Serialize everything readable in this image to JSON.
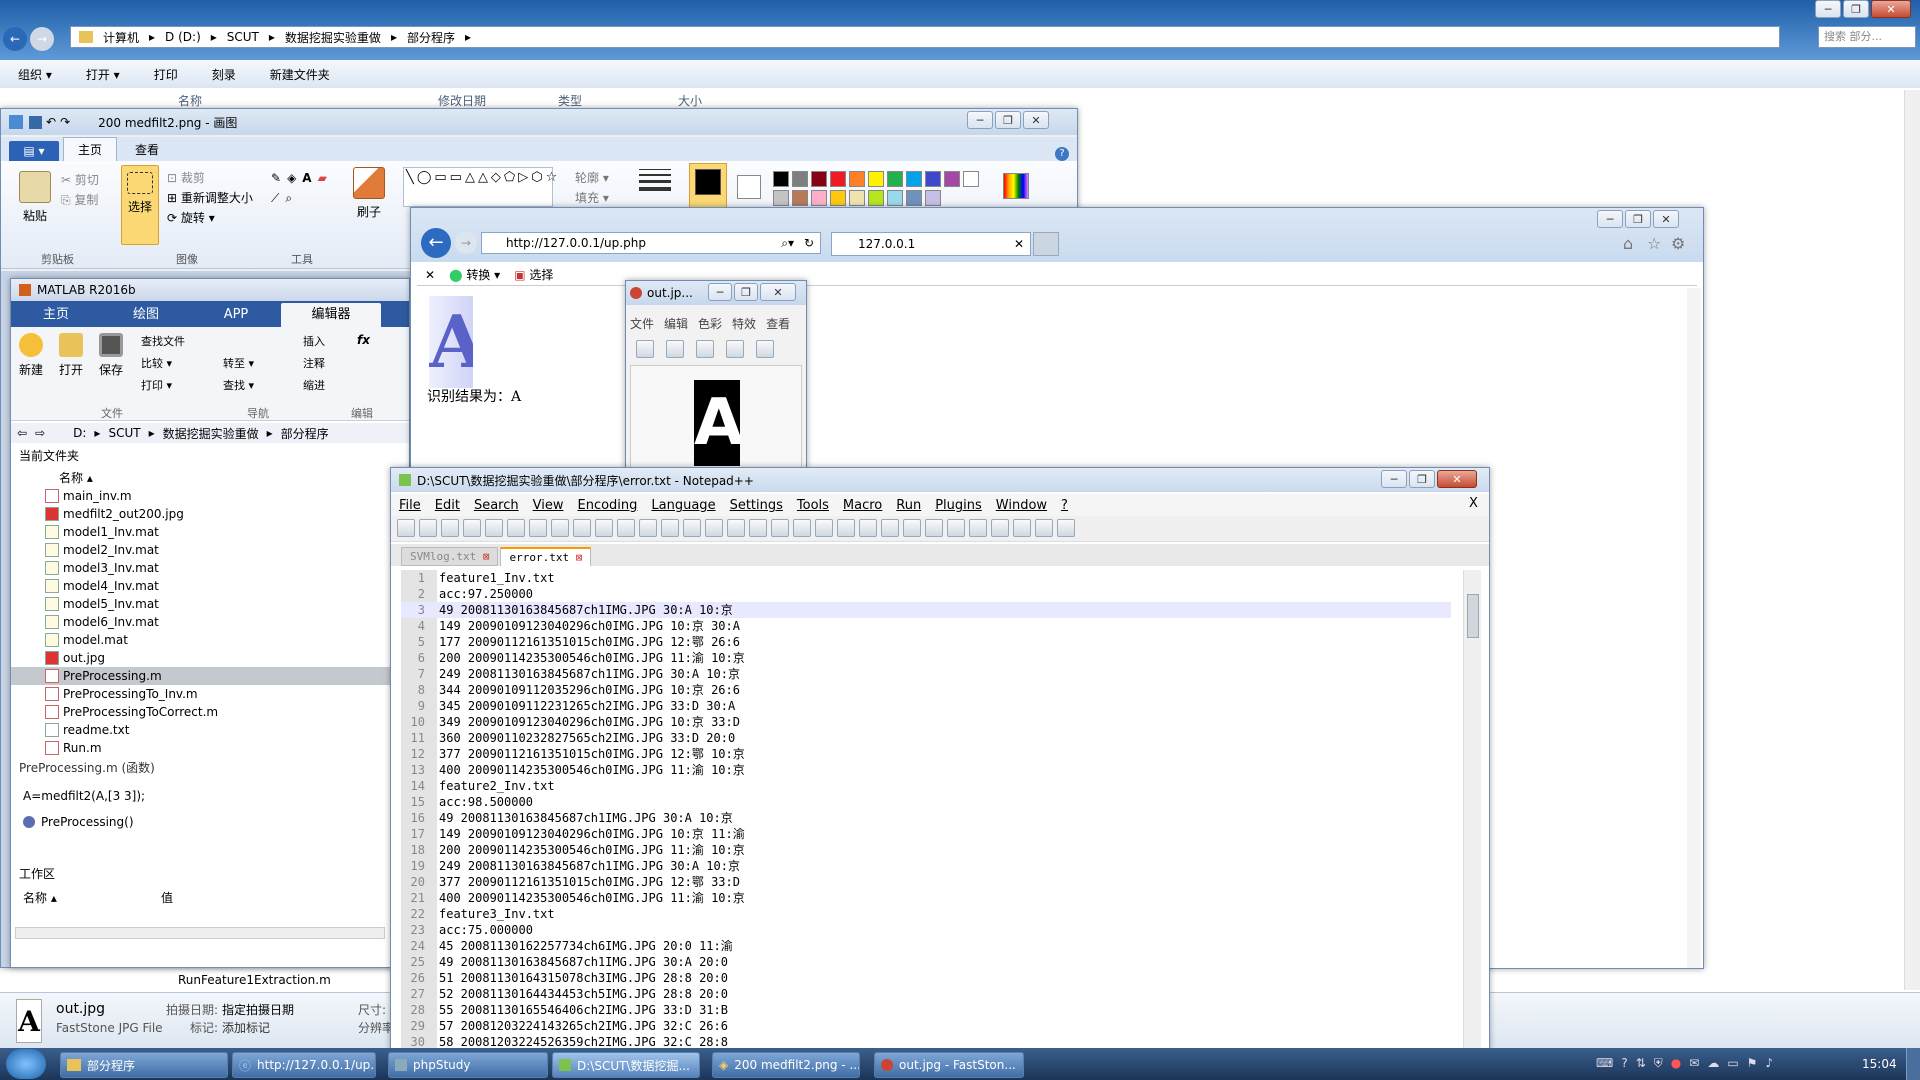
{
  "explorer": {
    "breadcrumb": [
      "计算机",
      "D (D:)",
      "SCUT",
      "数据挖掘实验重做",
      "部分程序"
    ],
    "search_placeholder": "搜索 部分...",
    "toolbar": [
      "组织 ▾",
      "打开 ▾",
      "打印",
      "刻录",
      "新建文件夹"
    ],
    "columns": [
      "名称",
      "修改日期",
      "类型",
      "大小"
    ],
    "status": {
      "name": "out.jpg",
      "type": "FastStone JPG File",
      "k1": "拍摄日期:",
      "v1": "指定拍摄日期",
      "k2": "标记:",
      "v2": "添加标记",
      "k3": "尺寸:",
      "k4": "分辨率:"
    },
    "hidden_file": "RunFeature1Extraction.m"
  },
  "paint": {
    "title": "200 medfilt2.png - 画图",
    "tabs": [
      "主页",
      "查看"
    ],
    "clipboard": {
      "paste": "粘贴",
      "cut": "剪切",
      "copy": "复制",
      "group": "剪贴板"
    },
    "image": {
      "select": "选择",
      "crop": "裁剪",
      "resize": "重新调整大小",
      "rotate": "旋转 ▾",
      "group": "图像"
    },
    "tools_group": "工具",
    "brush": "刷子",
    "outline": "轮廓 ▾",
    "fill": "填充 ▾",
    "palette": [
      "#000000",
      "#7f7f7f",
      "#880015",
      "#ed1c24",
      "#ff7f27",
      "#fff200",
      "#22b14c",
      "#00a2e8",
      "#3f48cc",
      "#a349a4",
      "#ffffff",
      "#c3c3c3",
      "#b97a57",
      "#ffaec9",
      "#ffc90e",
      "#efe4b0",
      "#b5e61d",
      "#99d9ea",
      "#7092be",
      "#c8bfe7"
    ]
  },
  "matlab": {
    "title": "MATLAB R2016b",
    "tabs": [
      "主页",
      "绘图",
      "APP",
      "编辑器"
    ],
    "file_group": [
      "新建",
      "打开",
      "保存"
    ],
    "find_files": "查找文件",
    "compare": "比较 ▾",
    "print": "打印 ▾",
    "goto": "转至 ▾",
    "find": "查找 ▾",
    "insert": "插入",
    "comment": "注释",
    "indent": "缩进",
    "groups": [
      "文件",
      "导航",
      "编辑"
    ],
    "path": [
      "D:",
      "SCUT",
      "数据挖掘实验重做",
      "部分程序"
    ],
    "current_folder": "当前文件夹",
    "name_col": "名称 ▴",
    "files": [
      {
        "name": "main_inv.m",
        "type": "m"
      },
      {
        "name": "medfilt2_out200.jpg",
        "type": "jpg"
      },
      {
        "name": "model1_Inv.mat",
        "type": "mat"
      },
      {
        "name": "model2_Inv.mat",
        "type": "mat"
      },
      {
        "name": "model3_Inv.mat",
        "type": "mat"
      },
      {
        "name": "model4_Inv.mat",
        "type": "mat"
      },
      {
        "name": "model5_Inv.mat",
        "type": "mat"
      },
      {
        "name": "model6_Inv.mat",
        "type": "mat"
      },
      {
        "name": "model.mat",
        "type": "mat"
      },
      {
        "name": "out.jpg",
        "type": "jpg"
      },
      {
        "name": "PreProcessing.m",
        "type": "m",
        "selected": true
      },
      {
        "name": "PreProcessingTo_Inv.m",
        "type": "m"
      },
      {
        "name": "PreProcessingToCorrect.m",
        "type": "m"
      },
      {
        "name": "readme.txt",
        "type": "txt"
      },
      {
        "name": "Run.m",
        "type": "m"
      }
    ],
    "details_title": "PreProcessing.m (函数)",
    "details_code": "A=medfilt2(A,[3 3]);",
    "details_func": "PreProcessing()",
    "workspace": "工作区",
    "ws_cols": [
      "名称 ▴",
      "值"
    ]
  },
  "browser": {
    "url": "http://127.0.0.1/up.php",
    "tab": "127.0.0.1",
    "cmd_convert": "转换",
    "cmd_select": "选择",
    "glyph": "A",
    "result": "识别结果为：A"
  },
  "faststone": {
    "title": "out.jp...",
    "menu": [
      "文件",
      "编辑",
      "色彩",
      "特效",
      "查看"
    ],
    "glyph": "A"
  },
  "notepad": {
    "title": "D:\\SCUT\\数据挖掘实验重做\\部分程序\\error.txt - Notepad++",
    "menu": [
      "File",
      "Edit",
      "Search",
      "View",
      "Encoding",
      "Language",
      "Settings",
      "Tools",
      "Macro",
      "Run",
      "Plugins",
      "Window",
      "?"
    ],
    "close_x": "X",
    "tabs": [
      "SVMlog.txt",
      "error.txt"
    ],
    "lines": [
      "feature1_Inv.txt",
      "acc:97.250000",
      "49 20081130163845687ch1IMG.JPG 30:A 10:京",
      "149 20090109123040296ch0IMG.JPG 10:京 30:A",
      "177 20090112161351015ch0IMG.JPG 12:鄂 26:6",
      "200 20090114235300546ch0IMG.JPG 11:渝 10:京",
      "249 20081130163845687ch1IMG.JPG 30:A 10:京",
      "344 20090109112035296ch0IMG.JPG 10:京 26:6",
      "345 20090109112231265ch2IMG.JPG 33:D 30:A",
      "349 20090109123040296ch0IMG.JPG 10:京 33:D",
      "360 20090110232827565ch2IMG.JPG 33:D 20:0",
      "377 20090112161351015ch0IMG.JPG 12:鄂 10:京",
      "400 20090114235300546ch0IMG.JPG 11:渝 10:京",
      "feature2_Inv.txt",
      "acc:98.500000",
      "49 20081130163845687ch1IMG.JPG 30:A 10:京",
      "149 20090109123040296ch0IMG.JPG 10:京 11:渝",
      "200 20090114235300546ch0IMG.JPG 11:渝 10:京",
      "249 20081130163845687ch1IMG.JPG 30:A 10:京",
      "377 20090112161351015ch0IMG.JPG 12:鄂 33:D",
      "400 20090114235300546ch0IMG.JPG 11:渝 10:京",
      "feature3_Inv.txt",
      "acc:75.000000",
      "45 20081130162257734ch6IMG.JPG 20:0 11:渝",
      "49 20081130163845687ch1IMG.JPG 30:A 20:0",
      "51 20081130164315078ch3IMG.JPG 28:8 20:0",
      "52 20081130164434453ch5IMG.JPG 28:8 20:0",
      "55 20081130165546406ch2IMG.JPG 33:D 31:B",
      "57 20081203224143265ch2IMG.JPG 32:C 26:6",
      "58 20081203224526359ch2IMG.JPG 32:C 28:8"
    ]
  },
  "taskbar": {
    "items": [
      "部分程序",
      "http://127.0.0.1/up...",
      "phpStudy",
      "D:\\SCUT\\数据挖掘...",
      "200 medfilt2.png - ...",
      "out.jpg - FastSton..."
    ],
    "clock": "15:04"
  }
}
